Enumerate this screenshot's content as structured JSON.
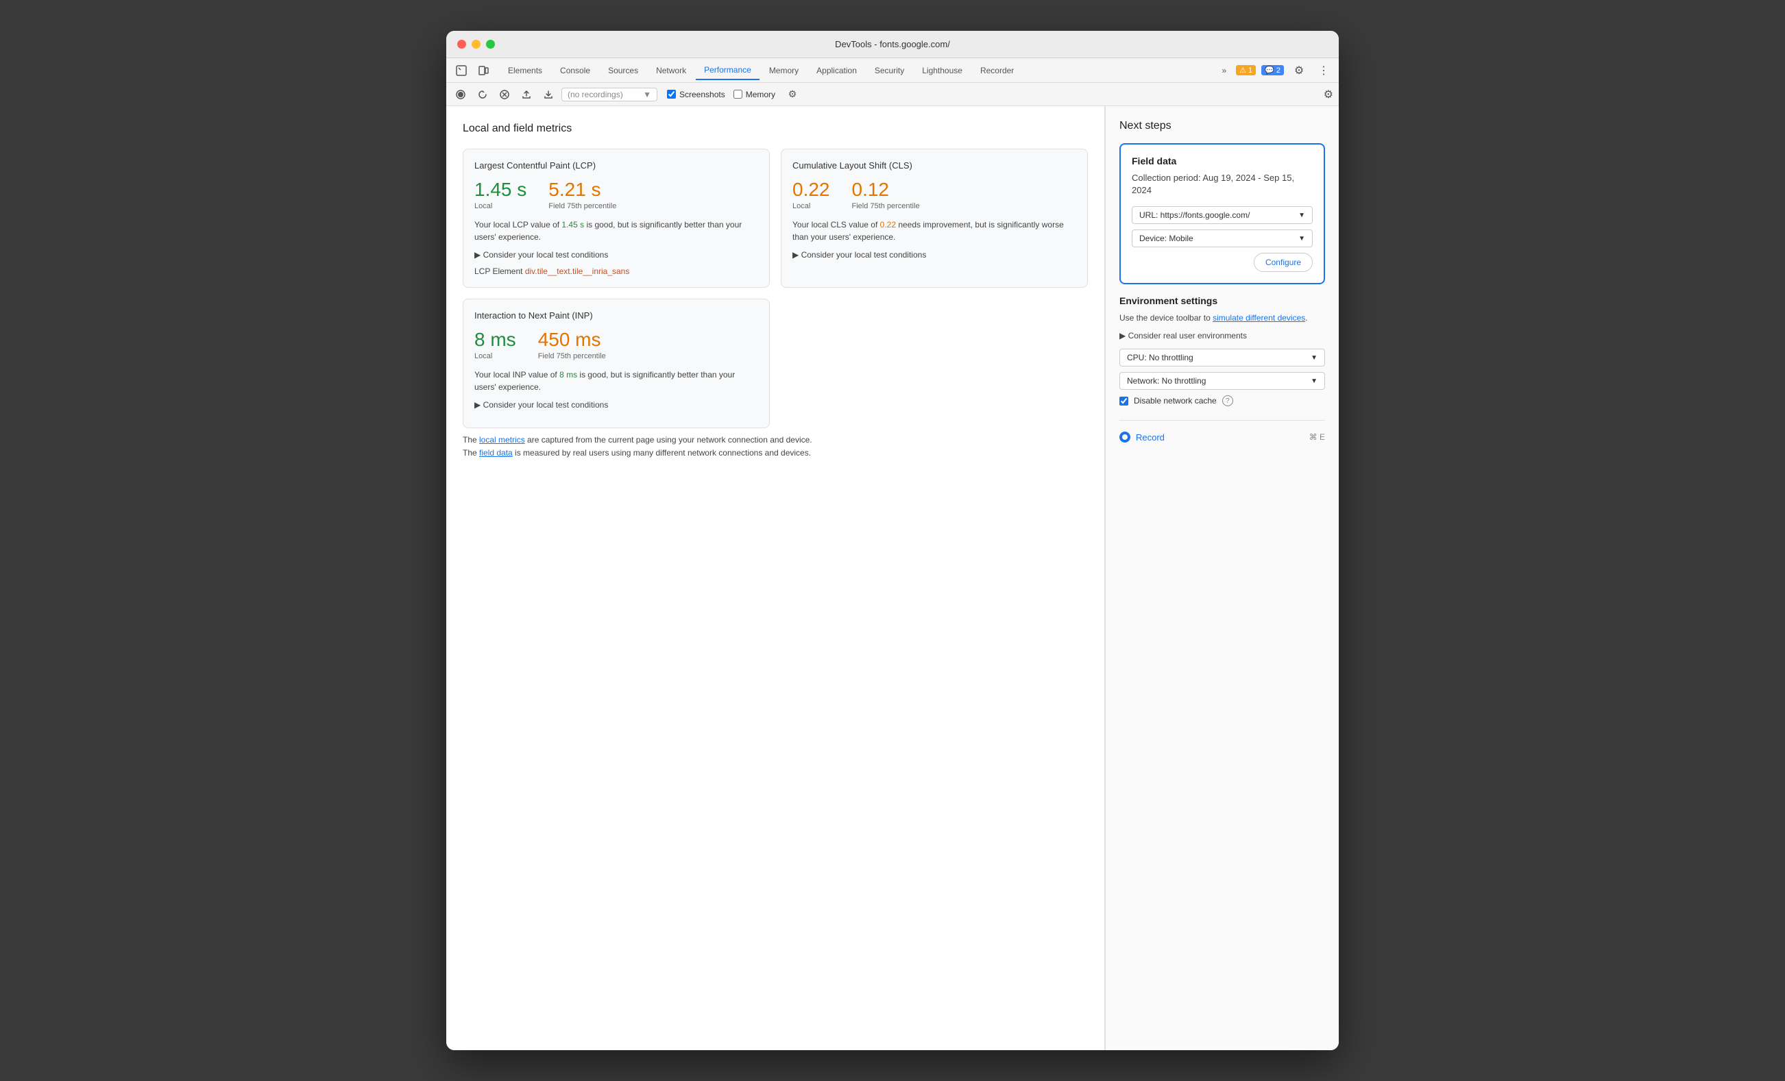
{
  "window": {
    "title": "DevTools - fonts.google.com/"
  },
  "tabs": {
    "items": [
      {
        "label": "Elements",
        "active": false
      },
      {
        "label": "Console",
        "active": false
      },
      {
        "label": "Sources",
        "active": false
      },
      {
        "label": "Network",
        "active": false
      },
      {
        "label": "Performance",
        "active": true
      },
      {
        "label": "Memory",
        "active": false
      },
      {
        "label": "Application",
        "active": false
      },
      {
        "label": "Security",
        "active": false
      },
      {
        "label": "Lighthouse",
        "active": false
      },
      {
        "label": "Recorder",
        "active": false
      }
    ],
    "more_label": "»",
    "warning_count": "1",
    "info_count": "2"
  },
  "action_bar": {
    "recording_placeholder": "(no recordings)",
    "screenshots_label": "Screenshots",
    "memory_label": "Memory"
  },
  "left_panel": {
    "title": "Local and field metrics",
    "lcp_card": {
      "title": "Largest Contentful Paint (LCP)",
      "local_value": "1.45 s",
      "field_value": "5.21 s",
      "local_label": "Local",
      "field_label": "Field 75th percentile",
      "description_prefix": "Your local LCP value of ",
      "description_local": "1.45 s",
      "description_mid": " is good, but is significantly better than your users' experience.",
      "toggle_text": "Consider your local test conditions",
      "element_label": "LCP Element",
      "element_link": "div.tile__text.tile__inria_sans"
    },
    "cls_card": {
      "title": "Cumulative Layout Shift (CLS)",
      "local_value": "0.22",
      "field_value": "0.12",
      "local_label": "Local",
      "field_label": "Field 75th percentile",
      "description_prefix": "Your local CLS value of ",
      "description_local": "0.22",
      "description_mid": " needs improvement, but is significantly worse than your users' experience.",
      "toggle_text": "Consider your local test conditions"
    },
    "inp_card": {
      "title": "Interaction to Next Paint (INP)",
      "local_value": "8 ms",
      "field_value": "450 ms",
      "local_label": "Local",
      "field_label": "Field 75th percentile",
      "description_prefix": "Your local INP value of ",
      "description_local": "8 ms",
      "description_mid": " is good, but is significantly better than your users' experience.",
      "toggle_text": "Consider your local test conditions"
    },
    "bottom_note": {
      "prefix": "The ",
      "link1": "local metrics",
      "mid": " are captured from the current page using your network connection and device.",
      "prefix2": "The ",
      "link2": "field data",
      "suffix": " is measured by real users using many different network connections and devices."
    }
  },
  "right_panel": {
    "title": "Next steps",
    "field_data": {
      "title": "Field data",
      "period": "Collection period: Aug 19, 2024 - Sep 15, 2024",
      "url_label": "URL: https://fonts.google.com/",
      "device_label": "Device: Mobile",
      "configure_label": "Configure"
    },
    "env_settings": {
      "title": "Environment settings",
      "description_prefix": "Use the device toolbar to ",
      "description_link": "simulate different devices",
      "description_suffix": ".",
      "toggle_text": "Consider real user environments",
      "cpu_label": "CPU: No throttling",
      "network_label": "Network: No throttling",
      "disable_cache_label": "Disable network cache"
    },
    "record": {
      "label": "Record",
      "shortcut": "⌘ E"
    }
  }
}
